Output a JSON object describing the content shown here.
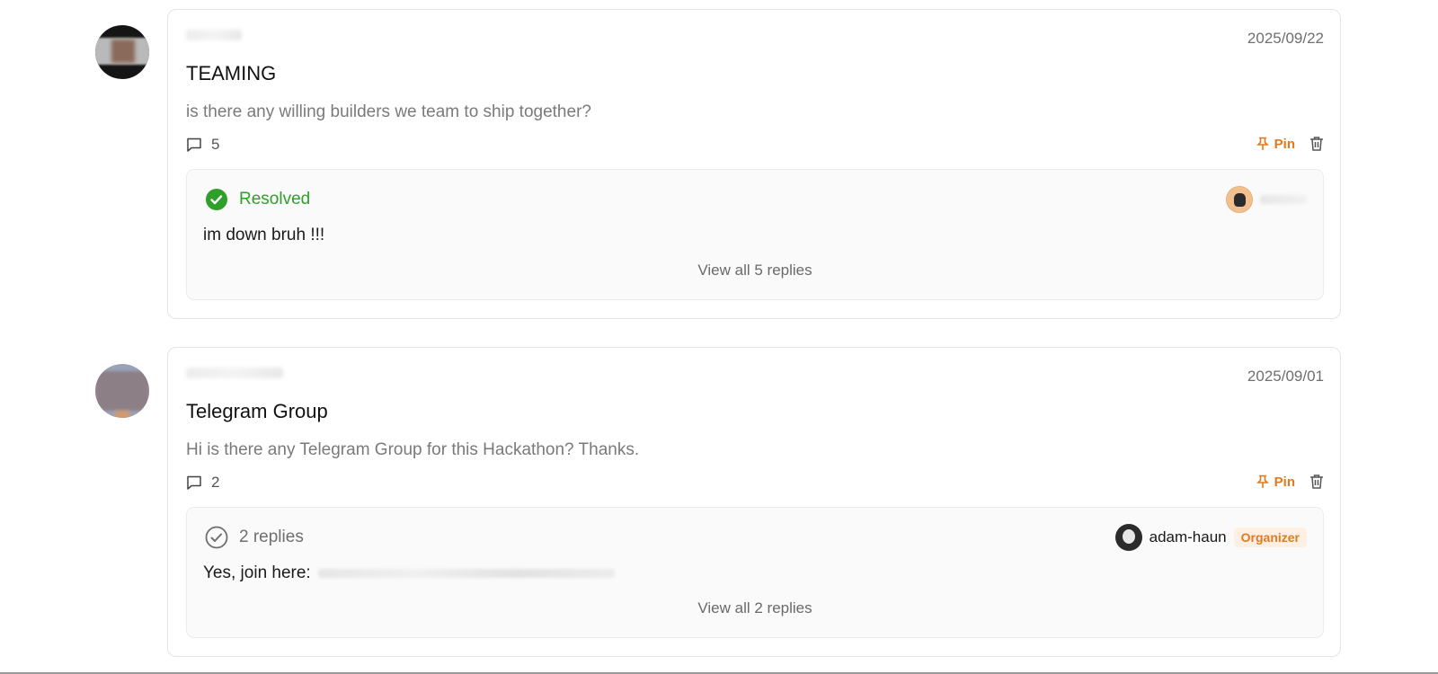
{
  "posts": [
    {
      "date": "2025/09/22",
      "title": "TEAMING",
      "body": "is there any willing builders we team to ship together?",
      "comment_count": "5",
      "pin_label": "Pin",
      "reply": {
        "status": "Resolved",
        "text": "im down bruh !!!",
        "view_all": "View all 5 replies"
      }
    },
    {
      "date": "2025/09/01",
      "title": "Telegram Group",
      "body": "Hi is there any Telegram Group for this Hackathon? Thanks.",
      "comment_count": "2",
      "pin_label": "Pin",
      "reply": {
        "status": "2 replies",
        "text": "Yes, join here:",
        "author": "adam-haun",
        "author_badge": "Organizer",
        "view_all": "View all 2 replies"
      }
    }
  ],
  "colors": {
    "accent": "#e07a1f",
    "resolved": "#2ea02a",
    "muted": "#7a7a7a"
  },
  "icons": {
    "comment": "comment-icon",
    "pin": "pin-icon",
    "trash": "trash-icon",
    "resolved": "check-circle-filled-icon",
    "pending": "check-circle-outline-icon"
  }
}
